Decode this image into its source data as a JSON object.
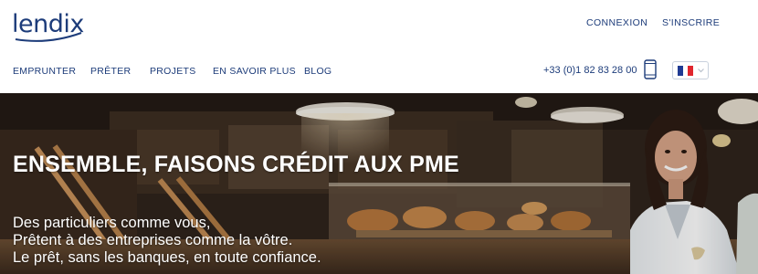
{
  "header": {
    "logo_text": "lendix",
    "top_links": {
      "login": "CONNEXION",
      "signup": "S'INSCRIRE"
    },
    "nav": [
      "EMPRUNTER",
      "PRÊTER",
      "PROJETS",
      "EN SAVOIR PLUS",
      "BLOG"
    ],
    "phone": "+33 (0)1 82 83 28 00",
    "phone_icon": "mobile-phone-icon",
    "language": {
      "flag": "fr-flag-icon",
      "icon": "chevron-down-icon"
    }
  },
  "hero": {
    "title": "ENSEMBLE, FAISONS CRÉDIT AUX PME",
    "lines": [
      "Des particuliers comme vous,",
      "Prêtent à des entreprises comme la vôtre.",
      "Le prêt, sans les banques, en toute confiance."
    ]
  },
  "colors": {
    "brand": "#1d3c7a",
    "hero_text": "#ffffff",
    "header_bg": "#ffffff"
  }
}
